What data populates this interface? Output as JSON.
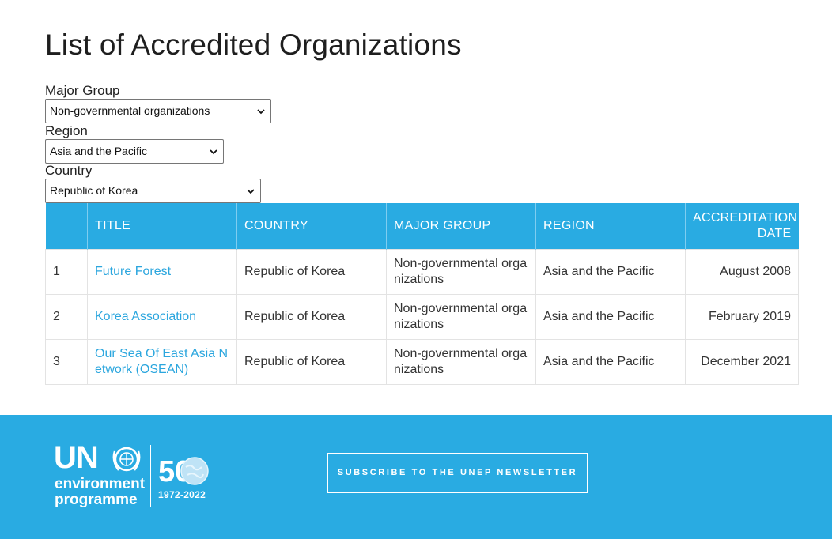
{
  "page": {
    "title": "List of Accredited Organizations"
  },
  "filters": {
    "major_group": {
      "label": "Major Group",
      "value": "Non-governmental organizations"
    },
    "region": {
      "label": "Region",
      "value": "Asia and the Pacific"
    },
    "country": {
      "label": "Country",
      "value": "Republic of Korea"
    }
  },
  "table": {
    "headers": [
      "",
      "TITLE",
      "COUNTRY",
      "MAJOR GROUP",
      "REGION",
      "ACCREDITATION DATE"
    ],
    "rows": [
      {
        "num": "1",
        "title": "Future Forest",
        "country": "Republic of Korea",
        "major_group": "Non-governmental organizations",
        "region": "Asia and the Pacific",
        "date": "August 2008"
      },
      {
        "num": "2",
        "title": "Korea Association",
        "country": "Republic of Korea",
        "major_group": "Non-governmental organizations",
        "region": "Asia and the Pacific",
        "date": "February 2019"
      },
      {
        "num": "3",
        "title": "Our Sea Of East Asia Network (OSEAN)",
        "country": "Republic of Korea",
        "major_group": "Non-governmental organizations",
        "region": "Asia and the Pacific",
        "date": "December 2021"
      }
    ]
  },
  "footer": {
    "logo": {
      "un": "UN",
      "line1": "environment",
      "line2": "programme",
      "fifty": "50",
      "years": "1972-2022",
      "emblem_icon": "un-emblem-icon",
      "globe_icon": "globe-icon"
    },
    "subscribe_label": "SUBSCRIBE TO THE UNEP NEWSLETTER"
  },
  "colors": {
    "accent": "#29abe2",
    "link": "#2ba6de"
  }
}
